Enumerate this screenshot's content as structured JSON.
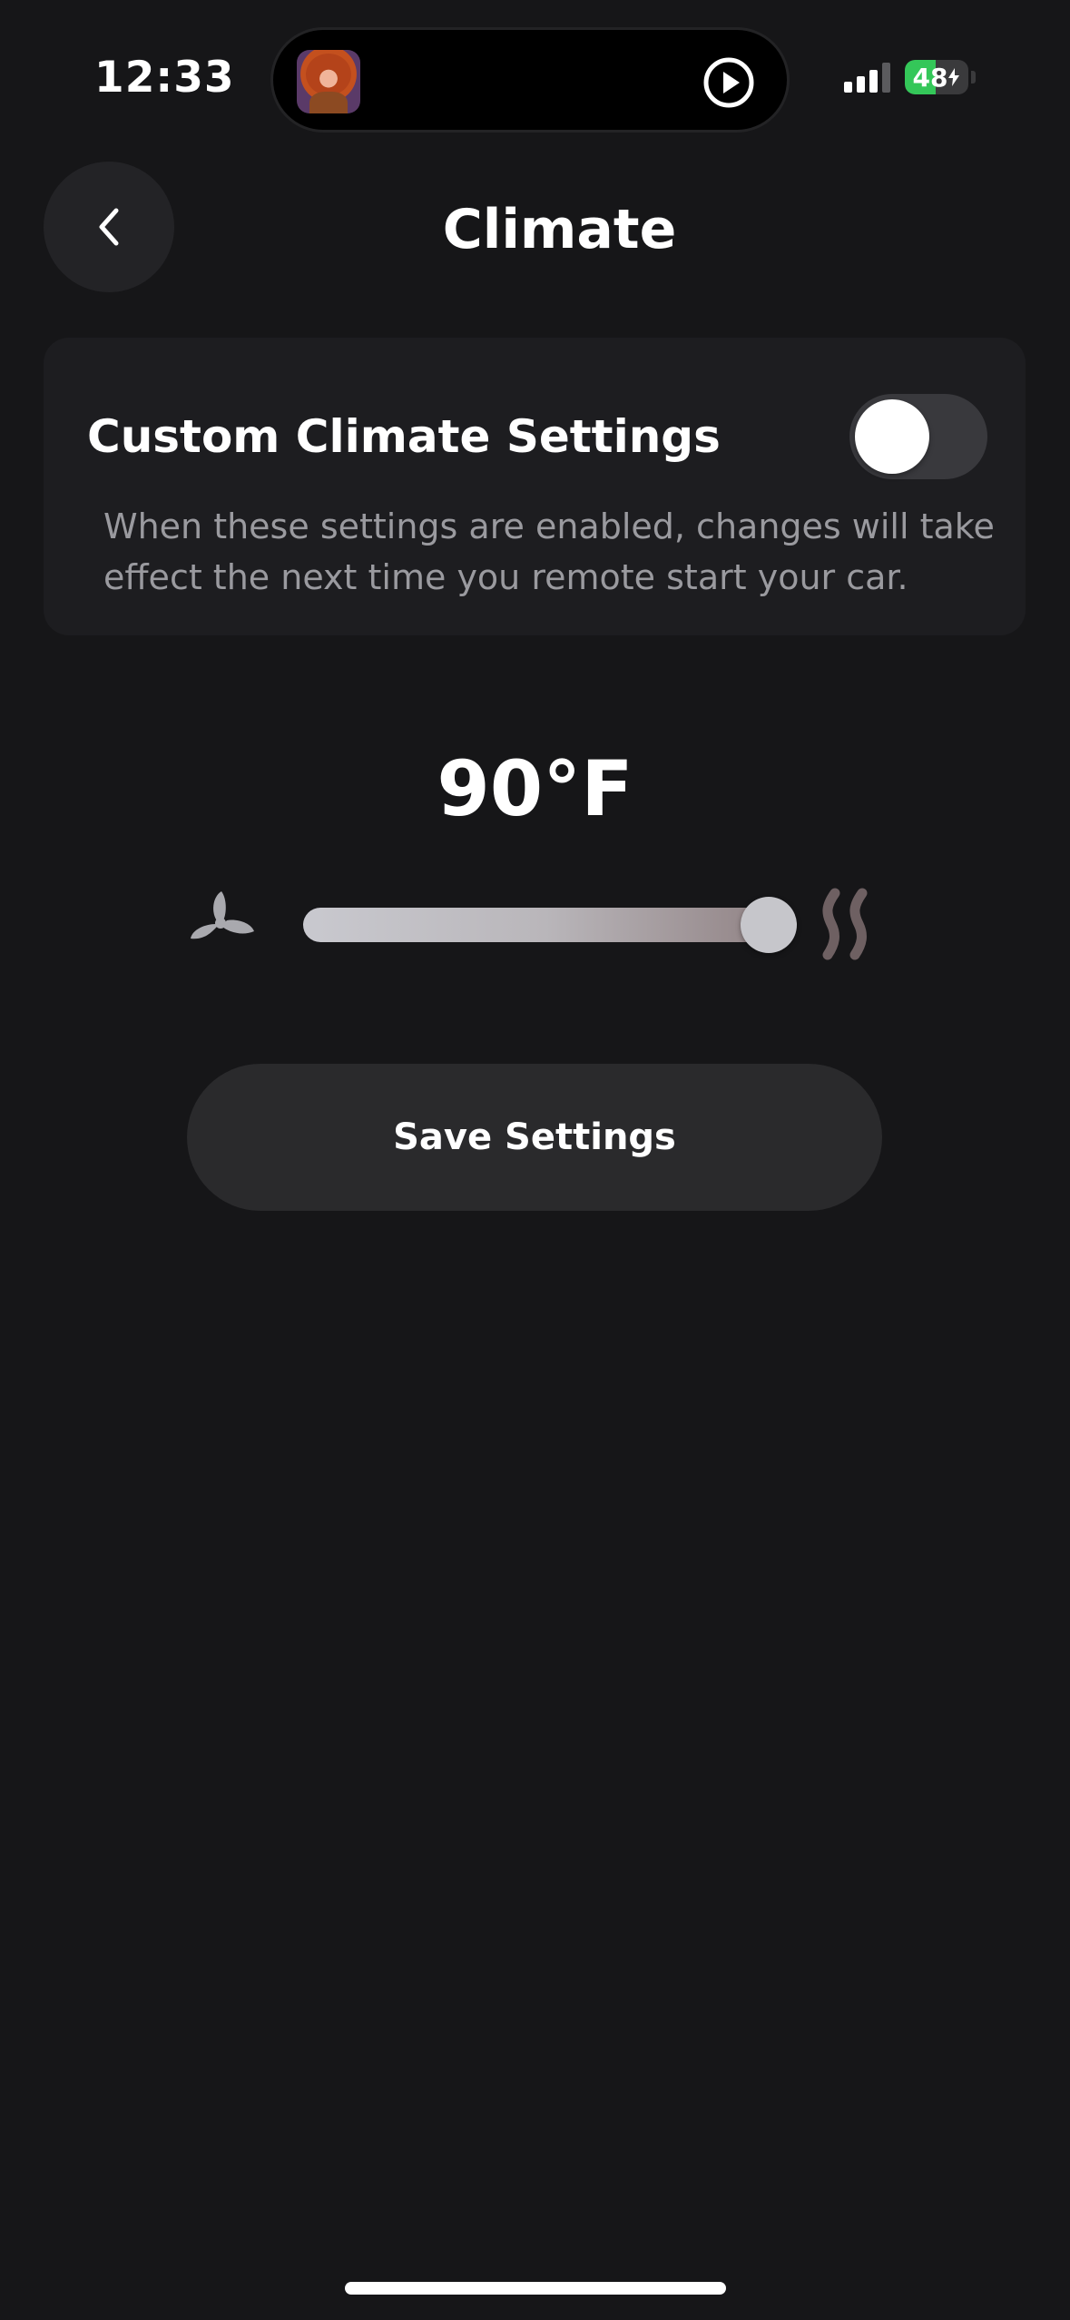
{
  "status_bar": {
    "time": "12:33",
    "battery_level": "48",
    "battery_fraction": 0.48,
    "signal_bars_active": 3,
    "signal_bars_total": 4,
    "battery_color": "#34c759",
    "island_icons": [
      "avatar-thumbnail",
      "play-circle-icon"
    ]
  },
  "header": {
    "title": "Climate",
    "back_icon": "chevron-left-icon"
  },
  "custom_settings": {
    "title": "Custom Climate Settings",
    "description": "When these settings are enabled, changes will take effect the next time you remote start your car.",
    "enabled": false
  },
  "temperature": {
    "value_label": "90°F",
    "slider_fraction": 1.0,
    "cool_icon": "fan-icon",
    "heat_icon": "heat-waves-icon"
  },
  "actions": {
    "save_label": "Save Settings"
  }
}
